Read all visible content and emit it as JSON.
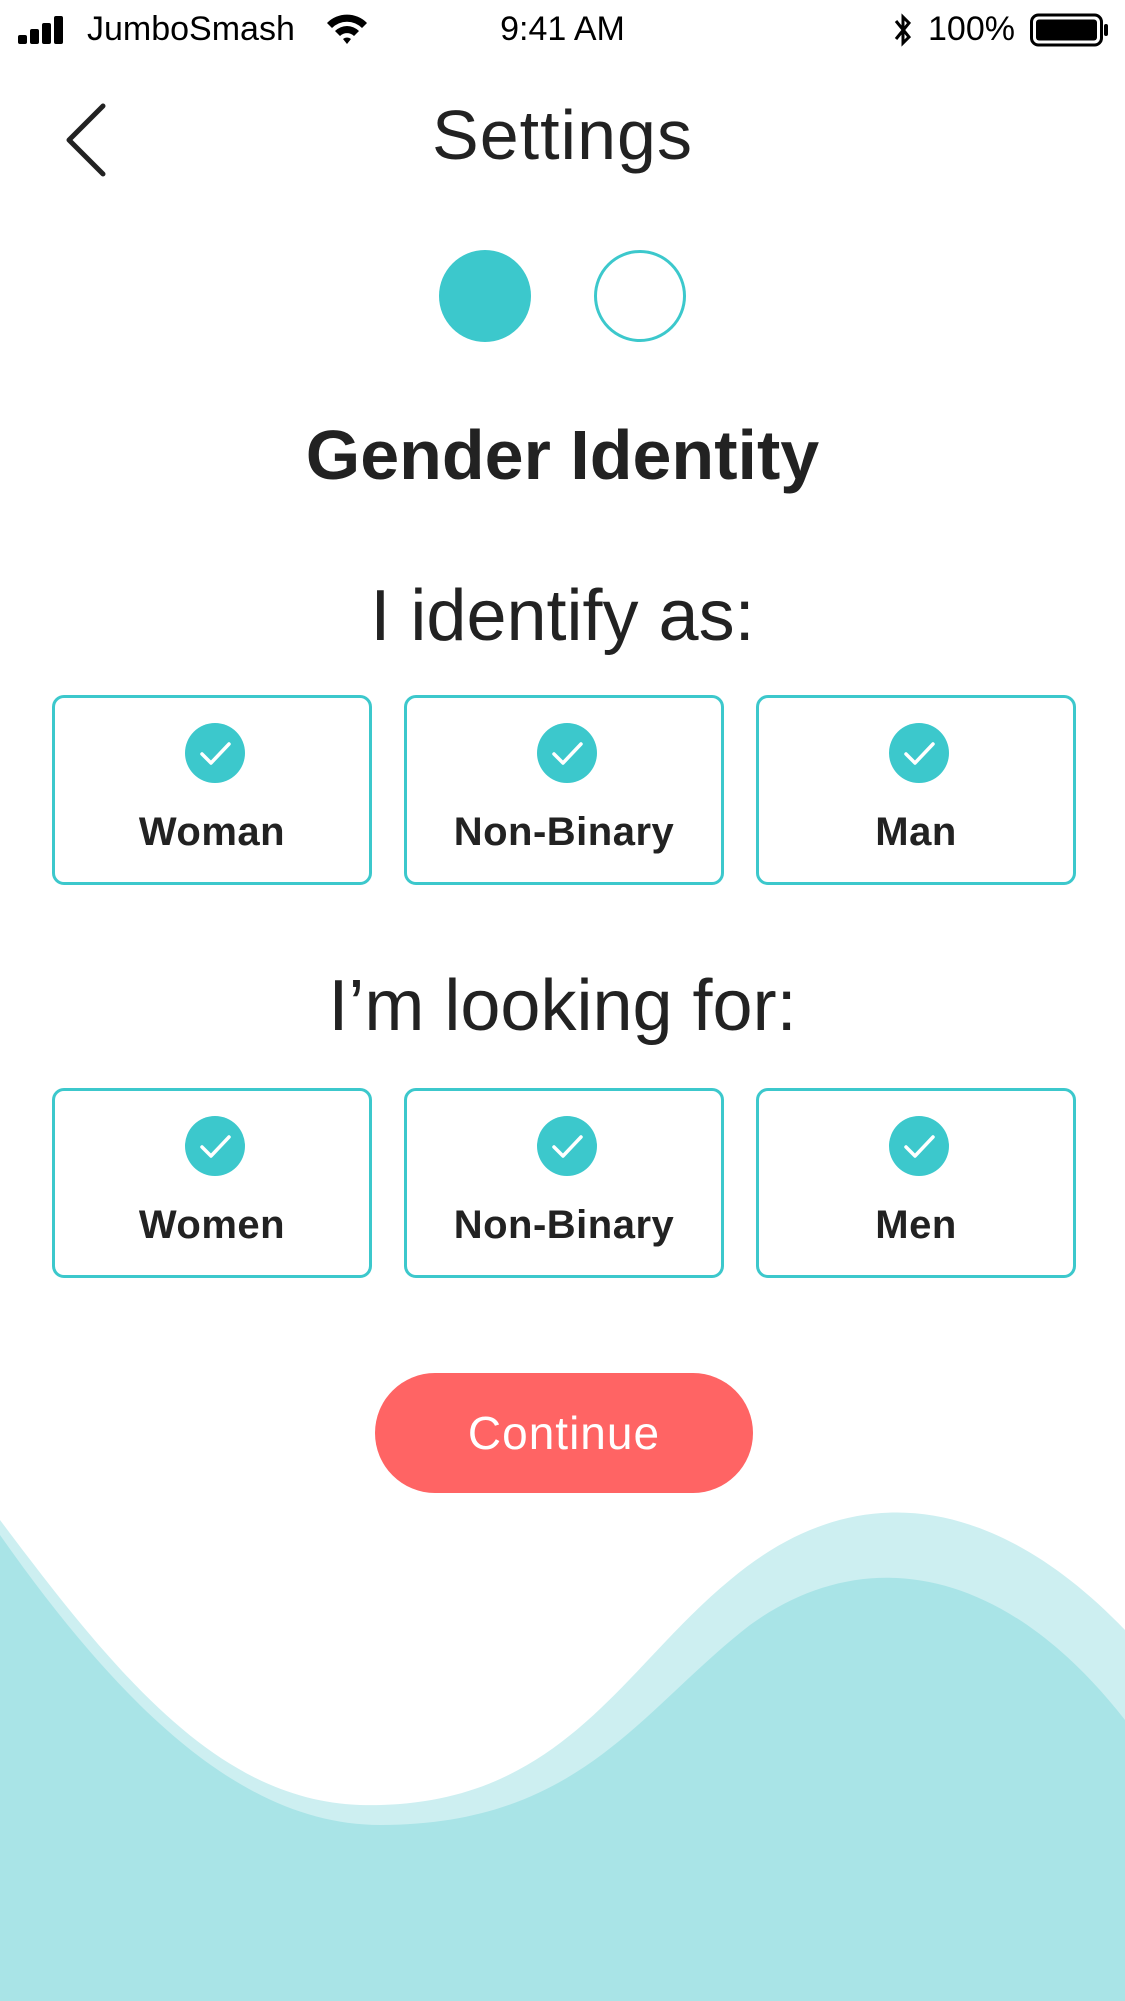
{
  "status_bar": {
    "carrier": "JumboSmash",
    "time": "9:41 AM",
    "battery": "100%"
  },
  "header": {
    "back_icon": "chevron-left-icon",
    "title": "Settings"
  },
  "steps": {
    "current": 1,
    "total": 2
  },
  "section_heading": "Gender Identity",
  "identify": {
    "question": "I identify as:",
    "options": [
      {
        "label": "Woman",
        "selected": true
      },
      {
        "label": "Non-Binary",
        "selected": true
      },
      {
        "label": "Man",
        "selected": true
      }
    ]
  },
  "looking_for": {
    "question": "I’m looking for:",
    "options": [
      {
        "label": "Women",
        "selected": true
      },
      {
        "label": "Non-Binary",
        "selected": true
      },
      {
        "label": "Men",
        "selected": true
      }
    ]
  },
  "continue_label": "Continue",
  "colors": {
    "accent": "#3cc8cc",
    "button": "#ff6464",
    "wave_light": "#cdeff1",
    "wave_dark": "#a9e4e7"
  }
}
